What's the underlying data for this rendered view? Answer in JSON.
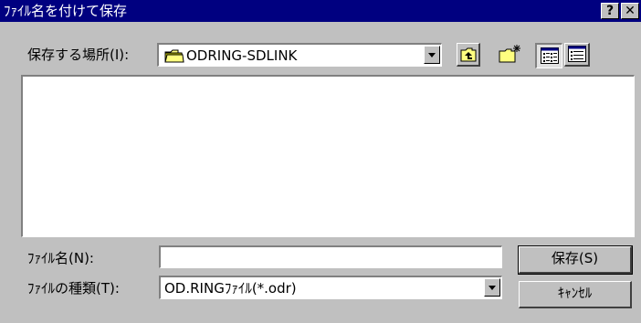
{
  "window": {
    "title": "ﾌｧｲﾙ名を付けて保存",
    "help_label": "?",
    "close_label": "✕"
  },
  "location": {
    "label": "保存する場所(I):",
    "value": "ODRING-SDLINK"
  },
  "filename": {
    "label": "ﾌｧｲﾙ名(N):",
    "value": ""
  },
  "filetype": {
    "label": "ﾌｧｲﾙの種類(T):",
    "value": "OD.RINGﾌｧｲﾙ(*.odr)"
  },
  "buttons": {
    "save": "保存(S)",
    "cancel": "ｷｬﾝｾﾙ"
  },
  "icons": {
    "folder": "folder-icon",
    "up": "up-folder-icon",
    "new_folder": "new-folder-icon",
    "list": "list-view-icon",
    "details": "details-view-icon"
  }
}
